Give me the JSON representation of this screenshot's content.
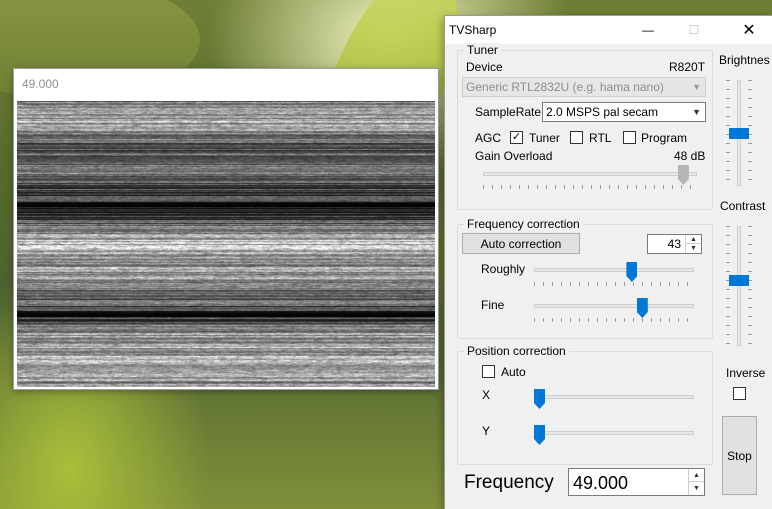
{
  "video_window": {
    "title": "49.000"
  },
  "control_window": {
    "title": "TVSharp",
    "titlebar": {
      "minimize": "—",
      "maximize": "☐",
      "close": "✕"
    },
    "tuner": {
      "group_label": "Tuner",
      "device_label": "Device",
      "tuner_model": "R820T",
      "device_value": "Generic RTL2832U (e.g. hama nano)",
      "samplerate_label": "SampleRate",
      "samplerate_value": "2.0 MSPS pal secam",
      "agc_label": "AGC",
      "agc_tuner_label": "Tuner",
      "agc_tuner_checked": true,
      "agc_rtl_label": "RTL",
      "agc_rtl_checked": false,
      "agc_program_label": "Program",
      "agc_program_checked": false,
      "gain_label": "Gain Overload",
      "gain_value": "48 dB",
      "gain_slider": 0.96
    },
    "frequency_correction": {
      "group_label": "Frequency correction",
      "auto_button": "Auto correction",
      "spin_value": "43",
      "roughly_label": "Roughly",
      "roughly_slider": 0.62,
      "fine_label": "Fine",
      "fine_slider": 0.69
    },
    "position_correction": {
      "group_label": "Position correction",
      "auto_label": "Auto",
      "auto_checked": false,
      "x_label": "X",
      "x_slider": 0.0,
      "y_label": "Y",
      "y_slider": 0.0
    },
    "brightness": {
      "label": "Brightnes",
      "level": 0.5
    },
    "contrast": {
      "label": "Contrast",
      "level": 0.45
    },
    "inverse": {
      "label": "Inverse",
      "checked": false
    },
    "stop_button": "Stop",
    "frequency": {
      "label": "Frequency",
      "value": "49.000"
    },
    "colors": {
      "accent": "#0078d7"
    }
  }
}
